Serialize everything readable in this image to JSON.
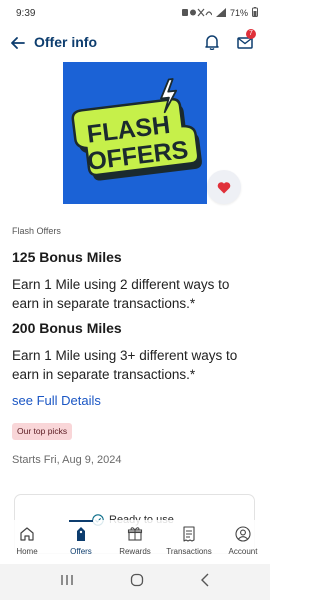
{
  "status_bar": {
    "time": "9:39",
    "battery": "71%"
  },
  "header": {
    "title": "Offer info",
    "mail_badge": "7"
  },
  "hero": {
    "line1": "FLASH",
    "line2": "OFFERS"
  },
  "offer": {
    "category": "Flash Offers",
    "items": [
      {
        "title": "125 Bonus Miles",
        "desc_line1": "Earn 1 Mile using 2 different ways to",
        "desc_line2": "earn in separate transactions.*"
      },
      {
        "title": "200 Bonus Miles",
        "desc_line1": "Earn 1 Mile using 3+ different ways to",
        "desc_line2": "earn in separate transactions.*"
      }
    ],
    "details_link": "see Full Details",
    "tag": "Our top picks",
    "starts": "Starts Fri, Aug 9, 2024",
    "ready_label": "Ready to use"
  },
  "nav": {
    "items": [
      {
        "label": "Home",
        "icon": "home-icon"
      },
      {
        "label": "Offers",
        "icon": "offers-tag-icon"
      },
      {
        "label": "Rewards",
        "icon": "gift-icon"
      },
      {
        "label": "Transactions",
        "icon": "receipt-icon"
      },
      {
        "label": "Account",
        "icon": "account-icon"
      }
    ]
  },
  "colors": {
    "brand": "#0d3d6e",
    "link": "#1a56c4",
    "hero_bg": "#1b62d6",
    "hero_badge": "#c6f04a",
    "heart": "#e0303a",
    "pill_bg": "#f9d6d8"
  }
}
